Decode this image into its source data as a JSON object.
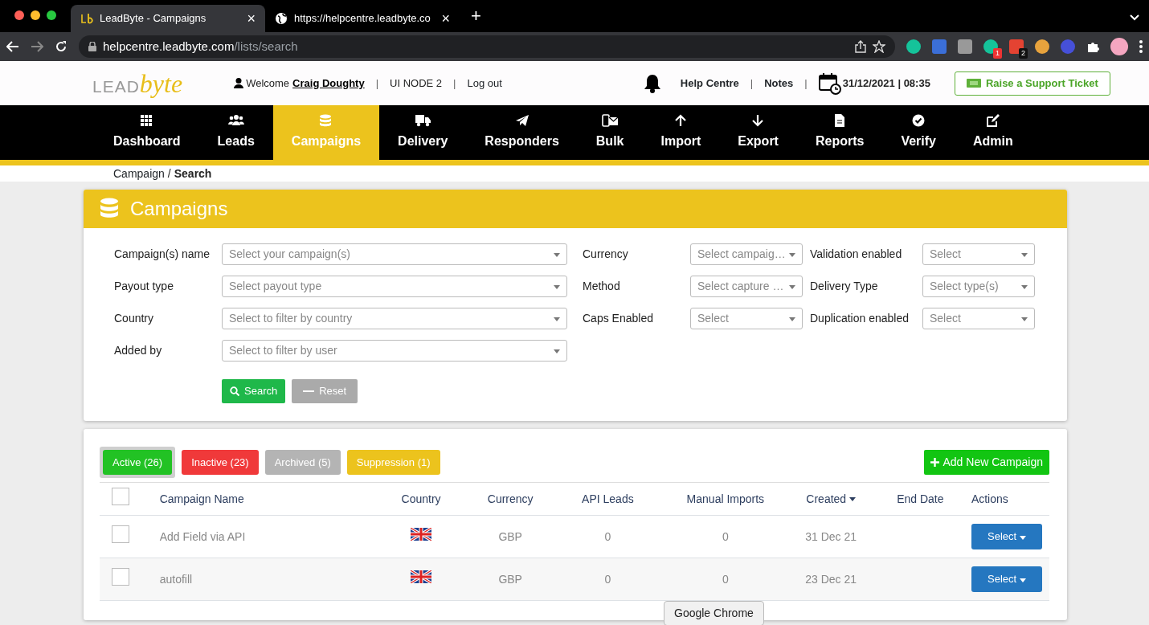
{
  "browser": {
    "tabs": [
      {
        "title": "LeadByte - Campaigns",
        "selected": true
      },
      {
        "title": "https://helpcentre.leadbyte.co",
        "selected": false
      }
    ],
    "new_tab": "+",
    "close": "×",
    "url": {
      "host": "helpcentre.leadbyte.com",
      "path": "/lists/search"
    },
    "extensions": [
      {
        "kind": "circle"
      },
      {
        "kind": "square"
      },
      {
        "kind": "square"
      },
      {
        "kind": "circle",
        "badge": "1"
      },
      {
        "kind": "square",
        "badge": "2"
      },
      {
        "kind": "circle"
      },
      {
        "kind": "circle"
      }
    ],
    "tooltip": "Google Chrome"
  },
  "header": {
    "logo": {
      "first": "LEAD",
      "second": "byte"
    },
    "welcome": "Welcome",
    "user": "Craig Doughty",
    "node": "UI NODE 2",
    "logout": "Log out",
    "help": "Help Centre",
    "notes": "Notes",
    "datetime": "31/12/2021 | 08:35",
    "ticket_button": "Raise a Support Ticket",
    "separators": [
      "|",
      "|",
      "|",
      "|"
    ]
  },
  "nav": [
    {
      "label": "Dashboard",
      "selected": false
    },
    {
      "label": "Leads",
      "selected": false
    },
    {
      "label": "Campaigns",
      "selected": true
    },
    {
      "label": "Delivery",
      "selected": false
    },
    {
      "label": "Responders",
      "selected": false
    },
    {
      "label": "Bulk",
      "selected": false
    },
    {
      "label": "Import",
      "selected": false
    },
    {
      "label": "Export",
      "selected": false
    },
    {
      "label": "Reports",
      "selected": false
    },
    {
      "label": "Verify",
      "selected": false
    },
    {
      "label": "Admin",
      "selected": false
    }
  ],
  "breadcrumb": {
    "parent": "Campaign",
    "current": "Search",
    "separator": "/"
  },
  "filter_panel": {
    "title": "Campaigns",
    "groups": [
      [
        {
          "label": "Campaign(s) name",
          "placeholder": "Select your campaign(s)"
        },
        {
          "label": "Payout type",
          "placeholder": "Select payout type"
        },
        {
          "label": "Country",
          "placeholder": "Select to filter by country"
        },
        {
          "label": "Added by",
          "placeholder": "Select to filter by user"
        }
      ],
      [
        {
          "label": "Currency",
          "placeholder": "Select campaig…"
        },
        {
          "label": "Method",
          "placeholder": "Select capture …"
        },
        {
          "label": "Caps Enabled",
          "placeholder": "Select"
        }
      ],
      [
        {
          "label": "Validation enabled",
          "placeholder": "Select"
        },
        {
          "label": "Delivery Type",
          "placeholder": "Select type(s)"
        },
        {
          "label": "Duplication enabled",
          "placeholder": "Select"
        }
      ]
    ],
    "search_button": "Search",
    "reset_button": "Reset"
  },
  "status_tabs": [
    {
      "label": "Active (26)",
      "color": "#22c224",
      "selected": true
    },
    {
      "label": "Inactive (23)",
      "color": "#f0393a",
      "selected": false
    },
    {
      "label": "Archived (5)",
      "color": "#b4b4b4",
      "selected": false
    },
    {
      "label": "Suppression (1)",
      "color": "#ecc31d",
      "selected": false
    }
  ],
  "add_button": "Add New Campaign",
  "table": {
    "header_checked": false,
    "columns": [
      {
        "label": "Campaign Name",
        "sorted": false
      },
      {
        "label": "Country",
        "sorted": false
      },
      {
        "label": "Currency",
        "sorted": false
      },
      {
        "label": "API Leads",
        "sorted": false
      },
      {
        "label": "Manual Imports",
        "sorted": false
      },
      {
        "label": "Created",
        "sorted": true
      },
      {
        "label": "End Date",
        "sorted": false
      },
      {
        "label": "Actions",
        "sorted": false
      }
    ],
    "rows": [
      {
        "checked": false,
        "name": "Add Field via API",
        "currency": "GBP",
        "api_leads": "0",
        "manual_imports": "0",
        "created": "31 Dec 21",
        "action": "Select"
      },
      {
        "checked": false,
        "name": "autofill",
        "currency": "GBP",
        "api_leads": "0",
        "manual_imports": "0",
        "created": "23 Dec 21",
        "action": "Select"
      }
    ]
  }
}
